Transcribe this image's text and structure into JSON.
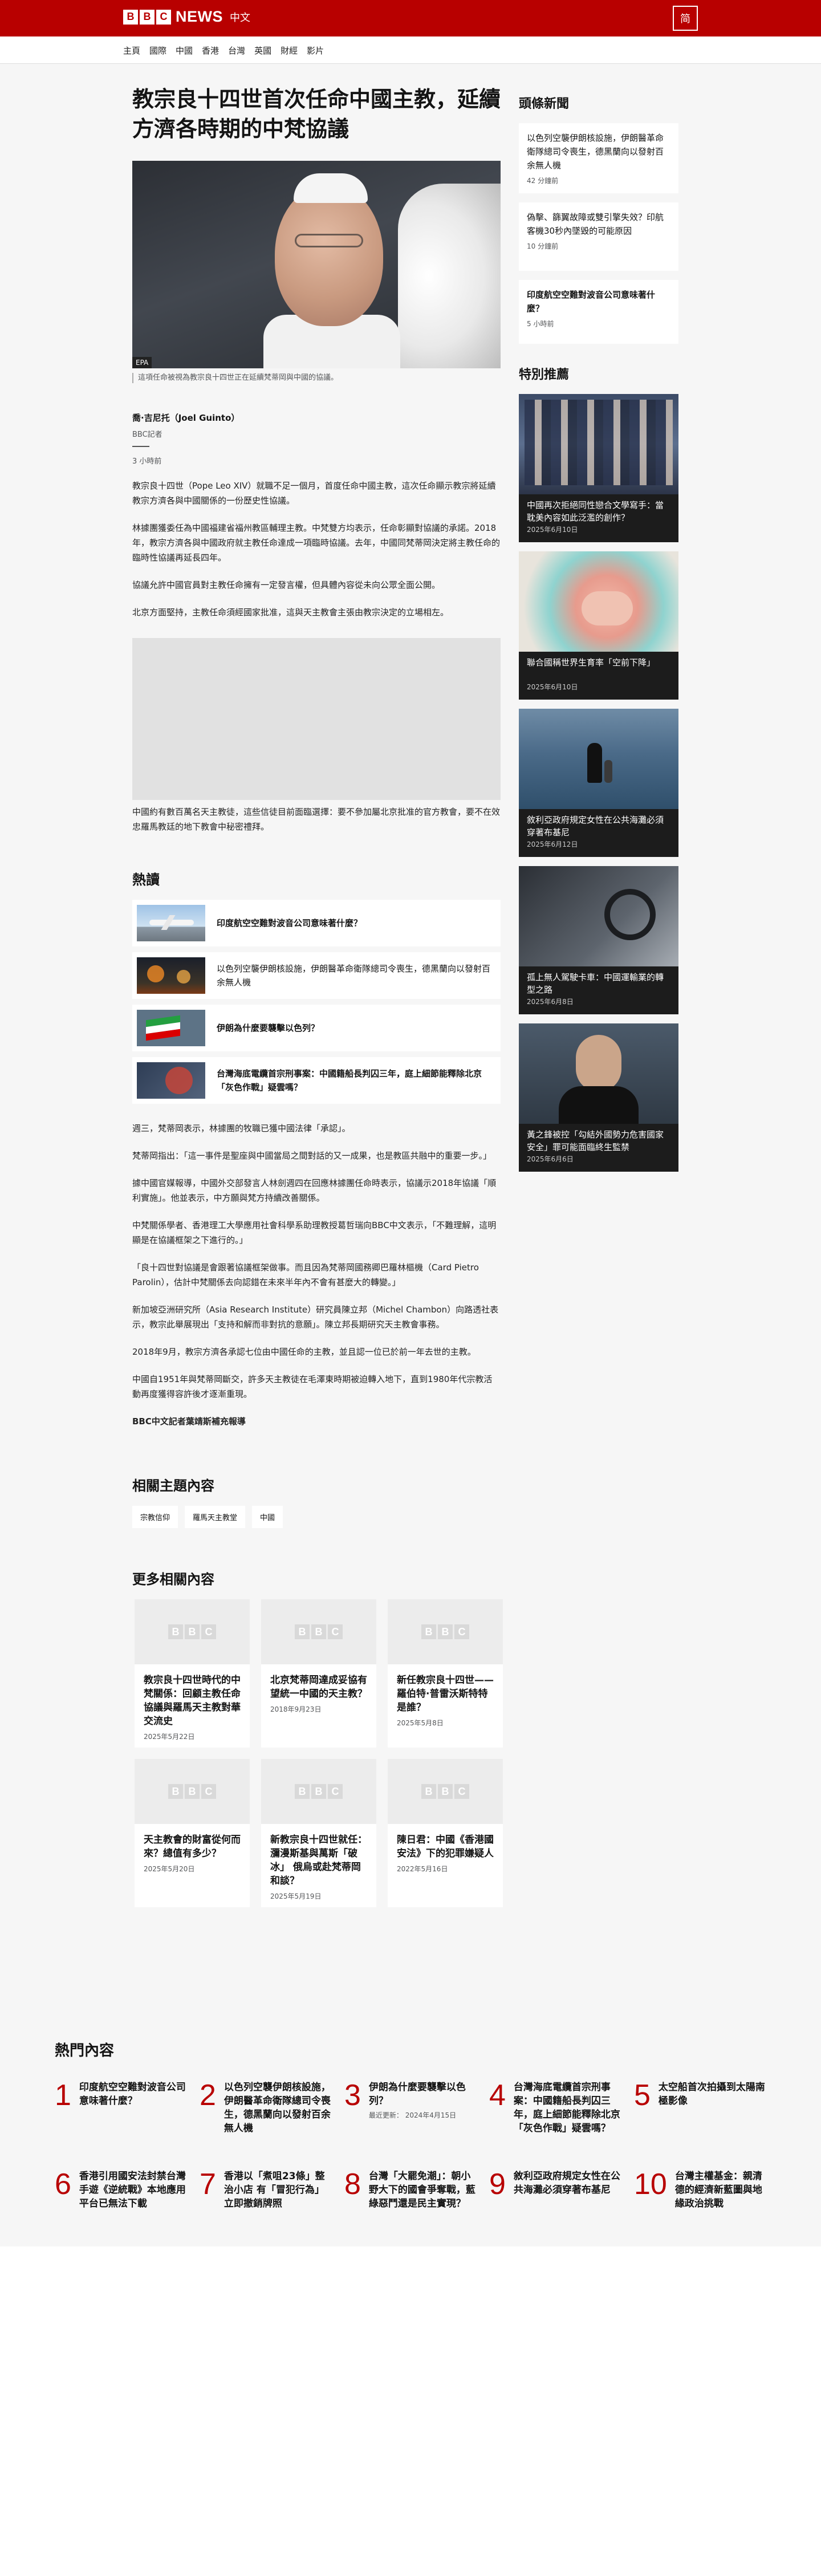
{
  "header": {
    "brand_letters": [
      "B",
      "B",
      "C"
    ],
    "brand_news": "NEWS",
    "brand_lang": "中文",
    "lang_switch": "简"
  },
  "nav": [
    "主頁",
    "國際",
    "中國",
    "香港",
    "台灣",
    "英國",
    "財經",
    "影片"
  ],
  "article": {
    "title": "教宗良十四世首次任命中國主教，延續方濟各時期的中梵協議",
    "hero_credit": "EPA",
    "caption": "這項任命被視為教宗良十四世正在延續梵蒂岡與中國的協議。",
    "author": "喬·吉尼托（Joel Guinto）",
    "author_role": "BBC記者",
    "time": "3 小時前",
    "paras_a": [
      "教宗良十四世（Pope Leo XIV）就職不足一個月，首度任命中國主教，這次任命顯示教宗將延續教宗方濟各與中國關係的一份歷史性協議。",
      "林據團獲委任為中國福建省福州教區輔理主教。中梵雙方均表示，任命彰顯對協議的承諾。2018年，教宗方濟各與中國政府就主教任命達成一項臨時協議。去年，中國同梵蒂岡決定將主教任命的臨時性協議再延長四年。",
      "協議允許中國官員對主教任命擁有一定發言權，但具體內容從未向公眾全面公開。",
      "北京方面堅持，主教任命須經國家批准，這與天主教會主張由教宗決定的立場相左。"
    ],
    "para_b": "中國約有數百萬名天主教徒，這些信徒目前面臨選擇：要不參加屬北京批准的官方教會，要不在效忠羅馬教廷的地下教會中秘密禮拜。",
    "paras_c": [
      "週三，梵蒂岡表示，林據團的牧職已獲中國法律「承認」。",
      "梵蒂岡指出：「這一事件是聖座與中國當局之間對話的又一成果，也是教區共融中的重要一步。」",
      "據中國官媒報導，中國外交部發言人林劍週四在回應林據團任命時表示，協議示2018年協議「順利實施」。他並表示，中方願與梵方持續改善關係。",
      "中梵關係學者、香港理工大學應用社會科學系助理教授葛哲瑞向BBC中文表示，「不難理解，這明顯是在協議框架之下進行的。」",
      "「良十四世對協議是會跟著協議框架做事。而且因為梵蒂岡國務卿巴羅林樞機（Card Pietro Parolin），估計中梵關係去向認錯在未來半年內不會有甚麼大的轉變。」",
      "新加坡亞洲研究所（Asia Research Institute）研究員陳立邦（Michel Chambon）向路透社表示，教宗此舉展現出「支持和解而非對抗的意願」。陳立邦長期研究天主教會事務。",
      "2018年9月，教宗方濟各承認七位由中國任命的主教，並且認一位已於前一年去世的主教。",
      "中國自1951年與梵蒂岡斷交，許多天主教徒在毛澤東時期被迫轉入地下，直到1980年代宗教活動再度獲得容許後才逐漸重現。"
    ],
    "supplement": "BBC中文記者葉靖斯補充報導",
    "hot_heading": "熱讀",
    "hot": [
      {
        "text": "印度航空空難對波音公司意味著什麼？",
        "bold": true
      },
      {
        "text": "以色列空襲伊朗核設施，伊朗醫革命衛隊總司令喪生，德黑蘭向以發射百余無人機",
        "bold": false
      },
      {
        "text": "伊朗為什麼要襲擊以色列？",
        "bold": true
      },
      {
        "text": "台灣海底電纜首宗刑事案：中國籍船長判囚三年，庭上細節能釋除北京「灰色作戰」疑雲嗎？",
        "bold": true
      }
    ],
    "topics_heading": "相關主題內容",
    "topics": [
      "宗教信仰",
      "羅馬天主教堂",
      "中國"
    ],
    "more_heading": "更多相關內容",
    "more": [
      {
        "title": "教宗良十四世時代的中梵關係：回顧主教任命協議與羅馬天主教對華交流史",
        "date": "2025年5月22日"
      },
      {
        "title": "北京梵蒂岡達成妥協有望統一中國的天主教？",
        "date": "2018年9月23日"
      },
      {
        "title": "新任教宗良十四世——羅伯特·普雷沃斯特特是誰？",
        "date": "2025年5月8日"
      },
      {
        "title": "天主教會的財富從何而來？總值有多少？",
        "date": "2025年5月20日"
      },
      {
        "title": "新教宗良十四世就任：瀰漫斯基與萬斯「破冰」 俄烏或赴梵蒂岡和談？",
        "date": "2025年5月19日"
      },
      {
        "title": "陳日君：中國《香港國安法》下的犯罪嫌疑人",
        "date": "2022年5月16日"
      }
    ]
  },
  "sidebar": {
    "top_heading": "頭條新聞",
    "top": [
      {
        "text": "以色列空襲伊朗核設施，伊朗醫革命衛隊總司令喪生，德黑蘭向以發射百余無人機",
        "time": "42 分鐘前",
        "bold": false
      },
      {
        "text": "偽擊、篩翼故障或雙引擎失效？印航客機30秒內墜毀的可能原因",
        "time": "10 分鐘前",
        "bold": false
      },
      {
        "text": "印度航空空難對波音公司意味著什麼？",
        "time": "5 小時前",
        "bold": true
      }
    ],
    "feat_heading": "特別推薦",
    "feat": [
      {
        "text": "中國再次拒絕同性戀合文學寫手：當耽美內容如此泛濫的創作？",
        "date": "2025年6月10日",
        "scene": "crowd"
      },
      {
        "text": "聯合國稱世界生育率「空前下降」",
        "date": "2025年6月10日",
        "scene": "baby"
      },
      {
        "text": "敘利亞政府規定女性在公共海灘必須穿著布基尼",
        "date": "2025年6月12日",
        "scene": "beach"
      },
      {
        "text": "孤上無人駕駛卡車：中國運輸業的轉型之路",
        "date": "2025年6月8日",
        "scene": "truck"
      },
      {
        "text": "黃之鋒被控「勾結外國勢力危害國家安全」罪可能面臨終生監禁",
        "date": "2025年6月6日",
        "scene": "portrait"
      }
    ]
  },
  "popular": {
    "heading": "熱門內容",
    "items": [
      {
        "n": "1",
        "text": "印度航空空難對波音公司意味著什麼？",
        "date": ""
      },
      {
        "n": "2",
        "text": "以色列空襲伊朗核設施，伊朗醫革命衛隊總司令喪生，德黑蘭向以發射百余無人機",
        "date": ""
      },
      {
        "n": "3",
        "text": "伊朗為什麼要襲擊以色列？",
        "date": "最近更新： 2024年4月15日"
      },
      {
        "n": "4",
        "text": "台灣海底電纜首宗刑事案：中國籍船長判囚三年，庭上細節能釋除北京「灰色作戰」疑雲嗎？",
        "date": ""
      },
      {
        "n": "5",
        "text": "太空船首次拍攝到太陽南極影像",
        "date": ""
      },
      {
        "n": "6",
        "text": "香港引用國安法封禁台灣手遊《逆統戰》本地應用平台已無法下載",
        "date": ""
      },
      {
        "n": "7",
        "text": "香港以「煮咀23條」整治小店 有「冒犯行為」立即撤銷牌照",
        "date": ""
      },
      {
        "n": "8",
        "text": "台灣「大罷免潮」：朝小野大下的國會爭奪戰，藍綠惡鬥還是民主實現？",
        "date": ""
      },
      {
        "n": "9",
        "text": "敘利亞政府規定女性在公共海灘必須穿著布基尼",
        "date": ""
      },
      {
        "n": "10",
        "text": "台灣主權基金：親清德的經濟新藍圖與地緣政治挑戰",
        "date": ""
      }
    ]
  }
}
